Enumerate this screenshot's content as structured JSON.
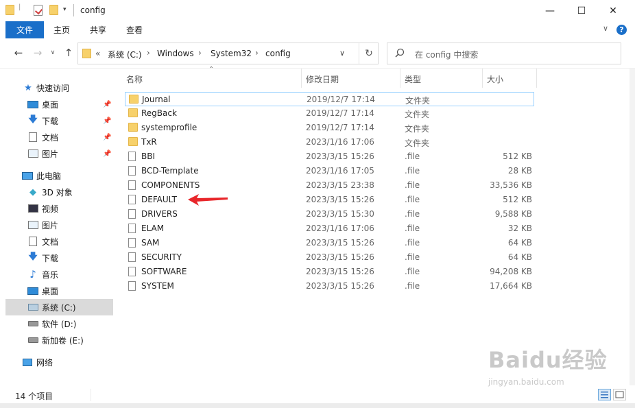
{
  "window": {
    "title": "config",
    "controls": {
      "minimize": "—",
      "maximize": "☐",
      "close": "✕"
    }
  },
  "ribbon": {
    "tabs": [
      {
        "label": "文件",
        "active": true
      },
      {
        "label": "主页",
        "active": false
      },
      {
        "label": "共享",
        "active": false
      },
      {
        "label": "查看",
        "active": false
      }
    ],
    "expand_chevron": "∨",
    "help": "?"
  },
  "address": {
    "prefix": "«",
    "crumbs": [
      "系统 (C:)",
      "Windows",
      "System32",
      "config"
    ],
    "separator": "›"
  },
  "search": {
    "placeholder": "在 config 中搜索"
  },
  "nav": {
    "quick_access": {
      "label": "快速访问",
      "items": [
        {
          "label": "桌面",
          "icon": "desktop-icon",
          "pinned": true
        },
        {
          "label": "下载",
          "icon": "download-icon",
          "pinned": true
        },
        {
          "label": "文档",
          "icon": "document-icon",
          "pinned": true
        },
        {
          "label": "图片",
          "icon": "picture-icon",
          "pinned": true
        }
      ]
    },
    "this_pc": {
      "label": "此电脑",
      "items": [
        {
          "label": "3D 对象",
          "icon": "3d-objects-icon"
        },
        {
          "label": "视频",
          "icon": "video-icon"
        },
        {
          "label": "图片",
          "icon": "picture-icon"
        },
        {
          "label": "文档",
          "icon": "document-icon"
        },
        {
          "label": "下载",
          "icon": "download-icon"
        },
        {
          "label": "音乐",
          "icon": "music-icon"
        },
        {
          "label": "桌面",
          "icon": "desktop-icon"
        },
        {
          "label": "系统 (C:)",
          "icon": "system-drive-icon",
          "selected": true
        },
        {
          "label": "软件 (D:)",
          "icon": "drive-icon"
        },
        {
          "label": "新加卷 (E:)",
          "icon": "drive-icon"
        }
      ]
    },
    "network": {
      "label": "网络"
    }
  },
  "columns": {
    "name": "名称",
    "modified": "修改日期",
    "type": "类型",
    "size": "大小"
  },
  "files": [
    {
      "name": "Journal",
      "modified": "2019/12/7 17:14",
      "type": "文件夹",
      "size": "",
      "kind": "folder"
    },
    {
      "name": "RegBack",
      "modified": "2019/12/7 17:14",
      "type": "文件夹",
      "size": "",
      "kind": "folder"
    },
    {
      "name": "systemprofile",
      "modified": "2019/12/7 17:14",
      "type": "文件夹",
      "size": "",
      "kind": "folder"
    },
    {
      "name": "TxR",
      "modified": "2023/1/16 17:06",
      "type": "文件夹",
      "size": "",
      "kind": "folder"
    },
    {
      "name": "BBI",
      "modified": "2023/3/15 15:26",
      "type": ".file",
      "size": "512 KB",
      "kind": "file"
    },
    {
      "name": "BCD-Template",
      "modified": "2023/1/16 17:05",
      "type": ".file",
      "size": "28 KB",
      "kind": "file"
    },
    {
      "name": "COMPONENTS",
      "modified": "2023/3/15 23:38",
      "type": ".file",
      "size": "33,536 KB",
      "kind": "file"
    },
    {
      "name": "DEFAULT",
      "modified": "2023/3/15 15:26",
      "type": ".file",
      "size": "512 KB",
      "kind": "file"
    },
    {
      "name": "DRIVERS",
      "modified": "2023/3/15 15:30",
      "type": ".file",
      "size": "9,588 KB",
      "kind": "file"
    },
    {
      "name": "ELAM",
      "modified": "2023/1/16 17:06",
      "type": ".file",
      "size": "32 KB",
      "kind": "file"
    },
    {
      "name": "SAM",
      "modified": "2023/3/15 15:26",
      "type": ".file",
      "size": "64 KB",
      "kind": "file"
    },
    {
      "name": "SECURITY",
      "modified": "2023/3/15 15:26",
      "type": ".file",
      "size": "64 KB",
      "kind": "file"
    },
    {
      "name": "SOFTWARE",
      "modified": "2023/3/15 15:26",
      "type": ".file",
      "size": "94,208 KB",
      "kind": "file"
    },
    {
      "name": "SYSTEM",
      "modified": "2023/3/15 15:26",
      "type": ".file",
      "size": "17,664 KB",
      "kind": "file"
    }
  ],
  "status": {
    "item_count": "14 个项目"
  },
  "watermark": {
    "main": "Baidu经验",
    "sub": "jingyan.baidu.com"
  },
  "colors": {
    "accent": "#1a6fc9",
    "folder": "#f7d16b",
    "annotation": "#e8262a",
    "selected_nav": "#dadada"
  }
}
